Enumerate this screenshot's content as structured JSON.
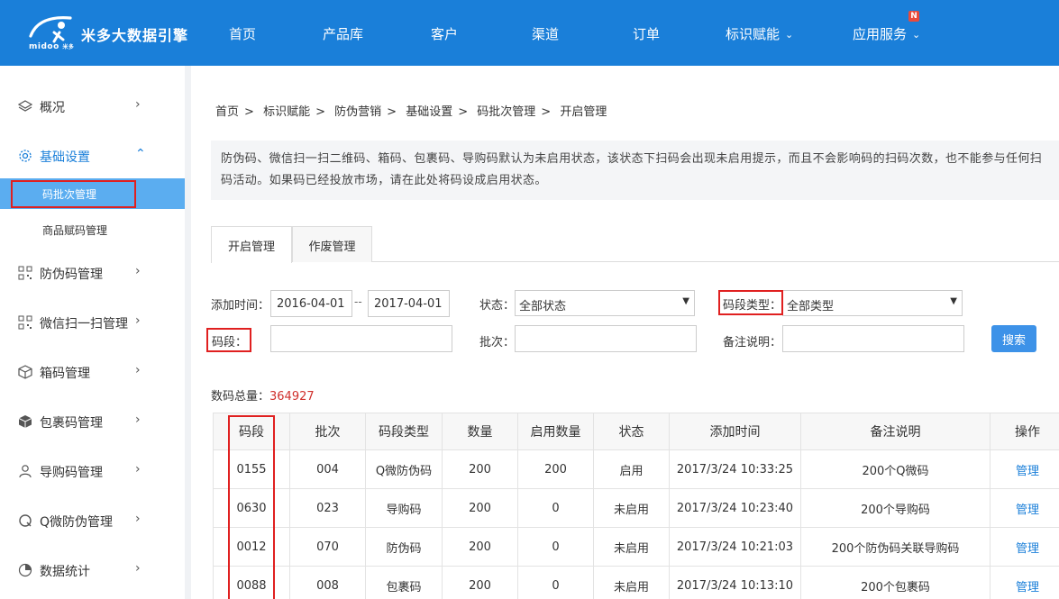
{
  "header": {
    "logo_sub": "midoo",
    "logo_tag": "米多",
    "brand": "米多大数据引擎",
    "nav": [
      {
        "label": "首页"
      },
      {
        "label": "产品库"
      },
      {
        "label": "客户"
      },
      {
        "label": "渠道"
      },
      {
        "label": "订单"
      },
      {
        "label": "标识赋能",
        "dropdown": true
      },
      {
        "label": "应用服务",
        "dropdown": true
      }
    ],
    "new_badge": "N",
    "colors": {
      "bar": "#1a7fd9"
    }
  },
  "sidebar": {
    "items": [
      {
        "label": "概况",
        "icon": "layers-icon"
      },
      {
        "label": "基础设置",
        "icon": "gear-icon",
        "open": true
      },
      {
        "label": "码批次管理",
        "sub": true,
        "active": true
      },
      {
        "label": "商品赋码管理",
        "sub": true
      },
      {
        "label": "防伪码管理",
        "icon": "qrcode-icon"
      },
      {
        "label": "微信扫一扫管理",
        "icon": "qrcode-icon"
      },
      {
        "label": "箱码管理",
        "icon": "box-icon"
      },
      {
        "label": "包裹码管理",
        "icon": "package-icon"
      },
      {
        "label": "导购码管理",
        "icon": "user-icon"
      },
      {
        "label": "Q微防伪管理",
        "icon": "q-icon"
      },
      {
        "label": "数据统计",
        "icon": "pie-chart-icon"
      }
    ]
  },
  "breadcrumb": [
    "首页",
    ">",
    "标识赋能",
    ">",
    "防伪营销",
    ">",
    "基础设置",
    ">",
    "码批次管理",
    ">",
    "开启管理"
  ],
  "notice": "防伪码、微信扫一扫二维码、箱码、包裹码、导购码默认为未启用状态，该状态下扫码会出现未启用提示，而且不会影响码的扫码次数，也不能参与任何扫码活动。如果码已经投放市场，请在此处将码设成启用状态。",
  "tabs": [
    {
      "label": "开启管理",
      "active": true
    },
    {
      "label": "作废管理"
    }
  ],
  "filters": {
    "date_label": "添加时间：",
    "date_from": "2016-04-01",
    "date_sep": "--",
    "date_to": "2017-04-01",
    "status_label": "状态：",
    "status_value": "全部状态",
    "type_label": "码段类型：",
    "type_value": "全部类型",
    "segment_label": "码段：",
    "segment_value": "",
    "batch_label": "批次：",
    "batch_value": "",
    "remark_label": "备注说明：",
    "remark_value": "",
    "search_button": "搜索"
  },
  "summary": {
    "label": "数码总量：",
    "value": "364927"
  },
  "table": {
    "columns": [
      "码段",
      "批次",
      "码段类型",
      "数量",
      "启用数量",
      "状态",
      "添加时间",
      "备注说明",
      "操作"
    ],
    "rows": [
      [
        "0155",
        "004",
        "Q微防伪码",
        "200",
        "200",
        "启用",
        "2017/3/24 10:33:25",
        "200个Q微码",
        "管理"
      ],
      [
        "0630",
        "023",
        "导购码",
        "200",
        "0",
        "未启用",
        "2017/3/24 10:23:40",
        "200个导购码",
        "管理"
      ],
      [
        "0012",
        "070",
        "防伪码",
        "200",
        "0",
        "未启用",
        "2017/3/24 10:21:03",
        "200个防伪码关联导购码",
        "管理"
      ],
      [
        "0088",
        "008",
        "包裹码",
        "200",
        "0",
        "未启用",
        "2017/3/24 10:13:10",
        "200个包裹码",
        "管理"
      ]
    ]
  },
  "colors": {
    "accent": "#1a7fd9",
    "highlight": "#e02020",
    "active_sub": "#5badf0"
  }
}
